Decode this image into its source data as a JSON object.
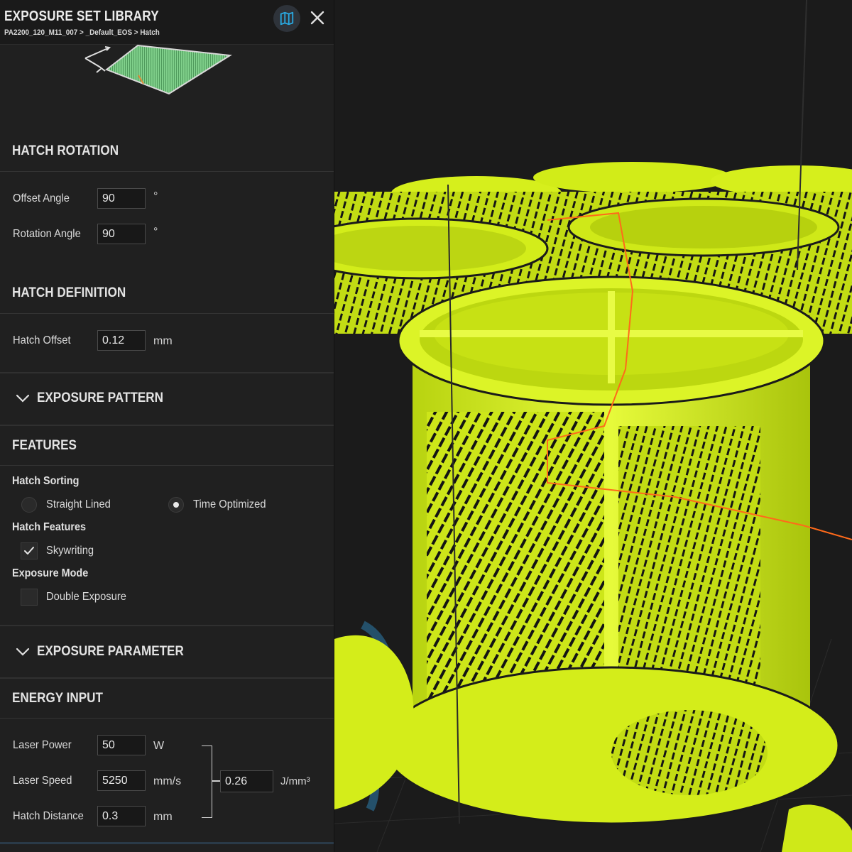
{
  "header": {
    "title": "EXPOSURE SET LIBRARY",
    "breadcrumb": "PA2200_120_M11_007 > _Default_EOS > Hatch",
    "map_icon": "map-icon",
    "close_icon": "close-icon"
  },
  "hatch_rotation": {
    "title": "HATCH ROTATION",
    "offset_angle": {
      "label": "Offset Angle",
      "value": "90",
      "unit": "°"
    },
    "rotation_angle": {
      "label": "Rotation Angle",
      "value": "90",
      "unit": "°"
    }
  },
  "hatch_definition": {
    "title": "HATCH DEFINITION",
    "hatch_offset": {
      "label": "Hatch Offset",
      "value": "0.12",
      "unit": "mm"
    }
  },
  "exposure_pattern": {
    "title": "EXPOSURE PATTERN",
    "icon": "chevron-down-icon"
  },
  "features": {
    "title": "FEATURES",
    "hatch_sorting": {
      "label": "Hatch Sorting",
      "options": [
        "Straight Lined",
        "Time Optimized"
      ],
      "selected": "Time Optimized"
    },
    "hatch_features": {
      "label": "Hatch Features",
      "skywriting": {
        "label": "Skywriting",
        "checked": true
      }
    },
    "exposure_mode": {
      "label": "Exposure Mode",
      "double_exposure": {
        "label": "Double Exposure",
        "checked": false
      }
    }
  },
  "exposure_parameter": {
    "title": "EXPOSURE PARAMETER",
    "icon": "chevron-down-icon"
  },
  "energy_input": {
    "title": "ENERGY INPUT",
    "laser_power": {
      "label": "Laser Power",
      "value": "50",
      "unit": "W"
    },
    "laser_speed": {
      "label": "Laser Speed",
      "value": "5250",
      "unit": "mm/s"
    },
    "hatch_distance": {
      "label": "Hatch Distance",
      "value": "0.3",
      "unit": "mm"
    },
    "energy_density": {
      "value": "0.26",
      "unit": "J/mm³"
    }
  },
  "viewport": {
    "part_color": "#d9f21a",
    "background": "#1b1b1b",
    "highlight_color": "#ff6a1a"
  }
}
